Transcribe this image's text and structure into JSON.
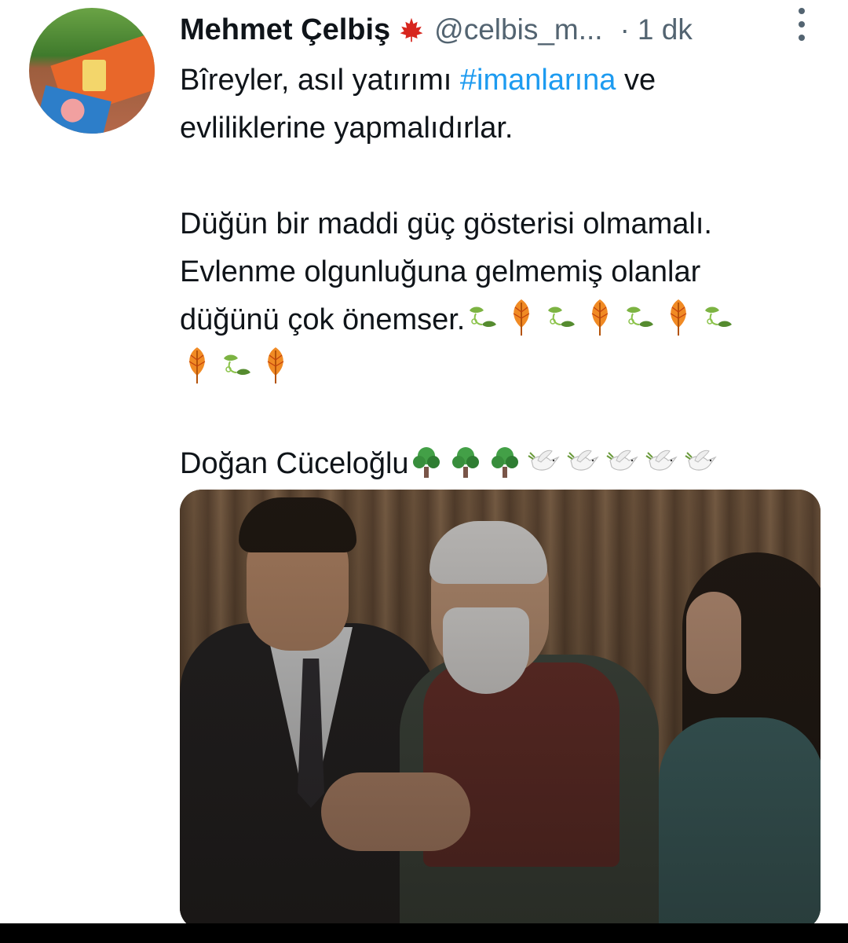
{
  "author": {
    "name": "Mehmet Çelbiş",
    "badge_icon": "maple-leaf-icon",
    "handle": "@celbis_m...",
    "separator": "·",
    "time": "1 dk"
  },
  "tweet": {
    "line1_before": "Bîreyler, asıl yatırımı ",
    "hashtag": "#imanlarına",
    "line1_after": " ve",
    "line2": "evliliklerine yapmalıdırlar.",
    "line3": "Düğün bir maddi güç gösterisi olmamalı.",
    "line4": "Evlenme olgunluğuna gelmemiş olanlar",
    "line5": "düğünü çok önemser.",
    "line7": "Doğan Cüceloğlu"
  },
  "emoji_rows": {
    "row5": [
      "leaves-icon",
      "autumn-leaf-icon",
      "leaves-icon",
      "autumn-leaf-icon",
      "leaves-icon",
      "autumn-leaf-icon",
      "leaves-icon"
    ],
    "row6": [
      "autumn-leaf-icon",
      "leaves-icon",
      "autumn-leaf-icon"
    ],
    "row7": [
      "tree-icon",
      "tree-icon",
      "tree-icon",
      "dove-icon",
      "dove-icon",
      "dove-icon",
      "dove-icon",
      "dove-icon"
    ]
  },
  "colors": {
    "text": "#0f1419",
    "secondary": "#536471",
    "link": "#1d9bf0",
    "badge": "#d7261e"
  },
  "media": {
    "type": "photo"
  }
}
